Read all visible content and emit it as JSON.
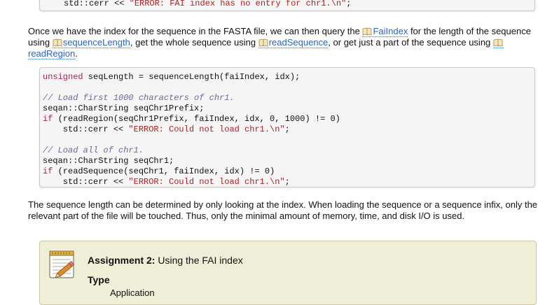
{
  "top_code": {
    "indent": "    ",
    "prefix": "std::cerr << ",
    "string": "\"ERROR: FAI index has no entry for chr1.\\n\"",
    "suffix": ";"
  },
  "para1": {
    "t1": "Once we have the index for the sequence in the FASTA file, we can then query the ",
    "ref1": "FaiIndex",
    "t2": " for the length of the sequence using ",
    "ref2": "sequenceLength",
    "t3": ", get the whole sequence using ",
    "ref3": "readSequence",
    "t4": ", or get just a part of the sequence using ",
    "ref4": "readRegion",
    "t5": "."
  },
  "code": {
    "l1_kw": "unsigned",
    "l1_rest": " seqLength = sequenceLength(faiIndex, idx);",
    "l2": "// Load first 1000 characters of chr1.",
    "l3": "seqan::CharString seqChr1Prefix;",
    "l4_kw": "if",
    "l4_rest": " (readRegion(seqChr1Prefix, faiIndex, idx, 0, 1000) != 0)",
    "l5_pre": "    std::cerr << ",
    "l5_str": "\"ERROR: Could not load chr1.\\n\"",
    "l5_suf": ";",
    "l6": "// Load all of chr1.",
    "l7": "seqan::CharString seqChr1;",
    "l8_kw": "if",
    "l8_rest": " (readSequence(seqChr1, faiIndex, idx) != 0)",
    "l9_pre": "    std::cerr << ",
    "l9_str": "\"ERROR: Could not load chr1.\\n\"",
    "l9_suf": ";"
  },
  "para2": "The sequence length can be determined by only looking at the index. When loading the sequence or a sequence infix, only the relevant part of the file will be touched. Thus, only the minimal amount of memory, time, and disk I/O is used.",
  "assignment": {
    "title_bold": "Assignment 2:",
    "title_rest": " Using the FAI index",
    "type_label": "Type",
    "type_value": "Application"
  },
  "colors": {
    "link": "#2a63c3",
    "keyword": "#a8244a",
    "string": "#b02020",
    "comment": "#6a6a9a",
    "assignment_bg": "#efeed6"
  },
  "icons": [
    "book-icon",
    "notepad-pencil-icon"
  ]
}
